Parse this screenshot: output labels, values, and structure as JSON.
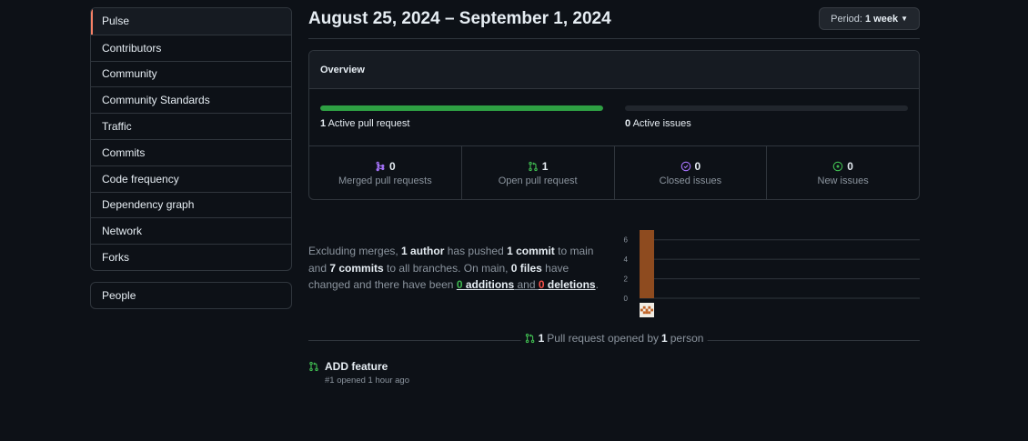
{
  "sidebar": {
    "items": [
      {
        "label": "Pulse",
        "selected": true
      },
      {
        "label": "Contributors"
      },
      {
        "label": "Community"
      },
      {
        "label": "Community Standards"
      },
      {
        "label": "Traffic"
      },
      {
        "label": "Commits"
      },
      {
        "label": "Code frequency"
      },
      {
        "label": "Dependency graph"
      },
      {
        "label": "Network"
      },
      {
        "label": "Forks"
      }
    ],
    "people_label": "People"
  },
  "header": {
    "date_range": "August 25, 2024 – September 1, 2024",
    "period_prefix": "Period:",
    "period_value": "1 week"
  },
  "overview": {
    "title": "Overview",
    "active_pr_count": "1",
    "active_pr_label": "Active pull request",
    "active_pr_fill": 1.0,
    "active_issues_count": "0",
    "active_issues_label": "Active issues",
    "active_issues_fill": 0.0,
    "stats": [
      {
        "count": "0",
        "label": "Merged pull requests",
        "icon": "merge-icon",
        "color": "#a371f7"
      },
      {
        "count": "1",
        "label": "Open pull request",
        "icon": "pull-request-icon",
        "color": "#3fb950"
      },
      {
        "count": "0",
        "label": "Closed issues",
        "icon": "issue-closed-icon",
        "color": "#a371f7"
      },
      {
        "count": "0",
        "label": "New issues",
        "icon": "issue-opened-icon",
        "color": "#3fb950"
      }
    ]
  },
  "summary": {
    "t1": "Excluding merges, ",
    "authors": "1 author",
    "t2": " has pushed ",
    "commits_main": "1 commit",
    "t3": " to main and ",
    "commits_all": "7 commits",
    "t4": " to all branches. On main, ",
    "files": "0 files",
    "t5": " have changed and there have been ",
    "additions_count": "0",
    "additions_label": " additions",
    "t6": " and ",
    "deletions_count": "0",
    "deletions_label": " deletions",
    "t7": "."
  },
  "chart_data": {
    "type": "bar",
    "categories": [
      "author-1"
    ],
    "values": [
      7
    ],
    "yticks": [
      "0",
      "2",
      "4",
      "6"
    ],
    "ylim": [
      0,
      7
    ],
    "bar_color": "#8e4b1f"
  },
  "pull_requests": {
    "count": "1",
    "t1": " Pull request opened by ",
    "people": "1",
    "t2": " person",
    "items": [
      {
        "title": "ADD feature",
        "meta": "#1 opened 1 hour ago"
      }
    ]
  }
}
